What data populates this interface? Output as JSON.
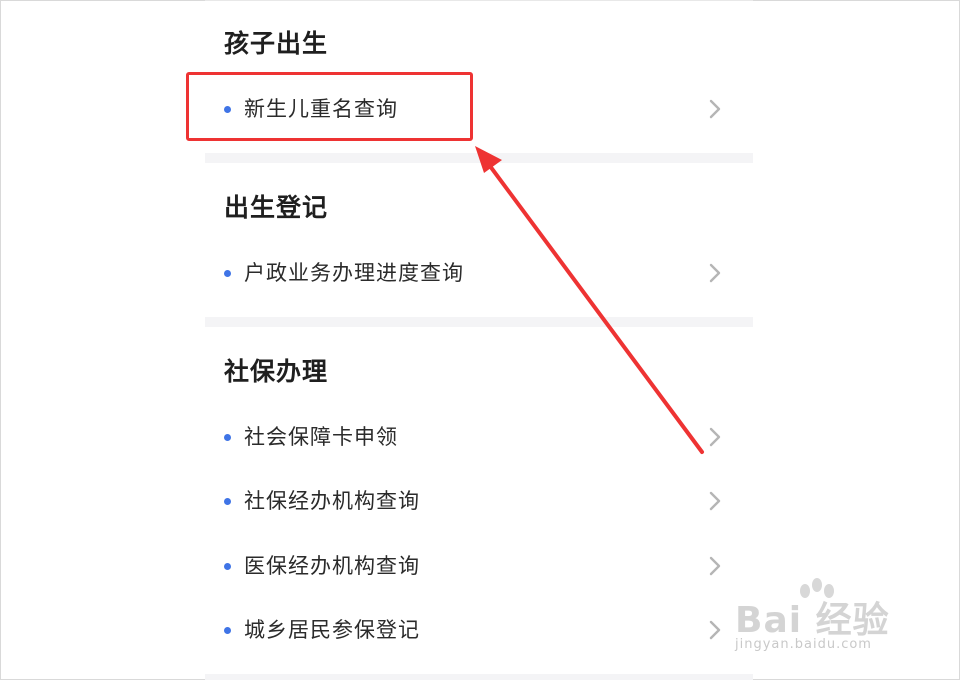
{
  "sections": [
    {
      "title": "孩子出生",
      "items": [
        {
          "label": "新生儿重名查询"
        }
      ]
    },
    {
      "title": "出生登记",
      "items": [
        {
          "label": "户政业务办理进度查询"
        }
      ]
    },
    {
      "title": "社保办理",
      "items": [
        {
          "label": "社会保障卡申领"
        },
        {
          "label": "社保经办机构查询"
        },
        {
          "label": "医保经办机构查询"
        },
        {
          "label": "城乡居民参保登记"
        }
      ]
    }
  ],
  "icons": {
    "item_bullet": "blue-dot",
    "item_arrow": "chevron-right-icon"
  },
  "colors": {
    "bullet": "#3f74e6",
    "highlight": "#ee3333",
    "annotation_arrow": "#ee3333"
  },
  "watermark": {
    "brand": "Bai 经验",
    "url": "jingyan.baidu.com"
  }
}
